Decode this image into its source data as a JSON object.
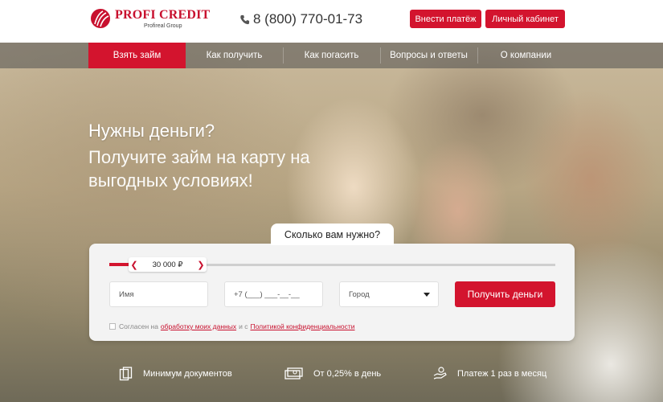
{
  "header": {
    "logo_name": "PROFI CREDIT",
    "logo_sub": "Profireal Group",
    "phone": "8 (800) 770-01-73",
    "pay_button": "Внести платёж",
    "cabinet_button": "Личный кабинет"
  },
  "nav": {
    "items": [
      {
        "label": "Взять займ"
      },
      {
        "label": "Как получить"
      },
      {
        "label": "Как погасить"
      },
      {
        "label": "Вопросы и ответы"
      },
      {
        "label": "О компании"
      }
    ]
  },
  "hero": {
    "title": "Нужны деньги?",
    "subtitle": "Получите займ на карту на выгодных условиях!"
  },
  "form": {
    "tab_label": "Сколько вам нужно?",
    "amount": "30 000 ₽",
    "amount_fraction": 0.04,
    "name_placeholder": "Имя",
    "phone_placeholder": "+7 (___) ___-__-__",
    "city_placeholder": "Город",
    "submit_label": "Получить деньги",
    "consent_text_1": "Согласен на",
    "consent_link_1": "обработку моих данных",
    "consent_text_2": "и с",
    "consent_link_2": "Политикой конфиденциальности"
  },
  "features": [
    {
      "icon": "documents-icon",
      "label": "Минимум документов"
    },
    {
      "icon": "money-icon",
      "label": "От 0,25% в день"
    },
    {
      "icon": "hand-coin-icon",
      "label": "Платеж 1 раз в месяц"
    }
  ],
  "colors": {
    "accent": "#d3142e",
    "logo": "#c8102e"
  }
}
